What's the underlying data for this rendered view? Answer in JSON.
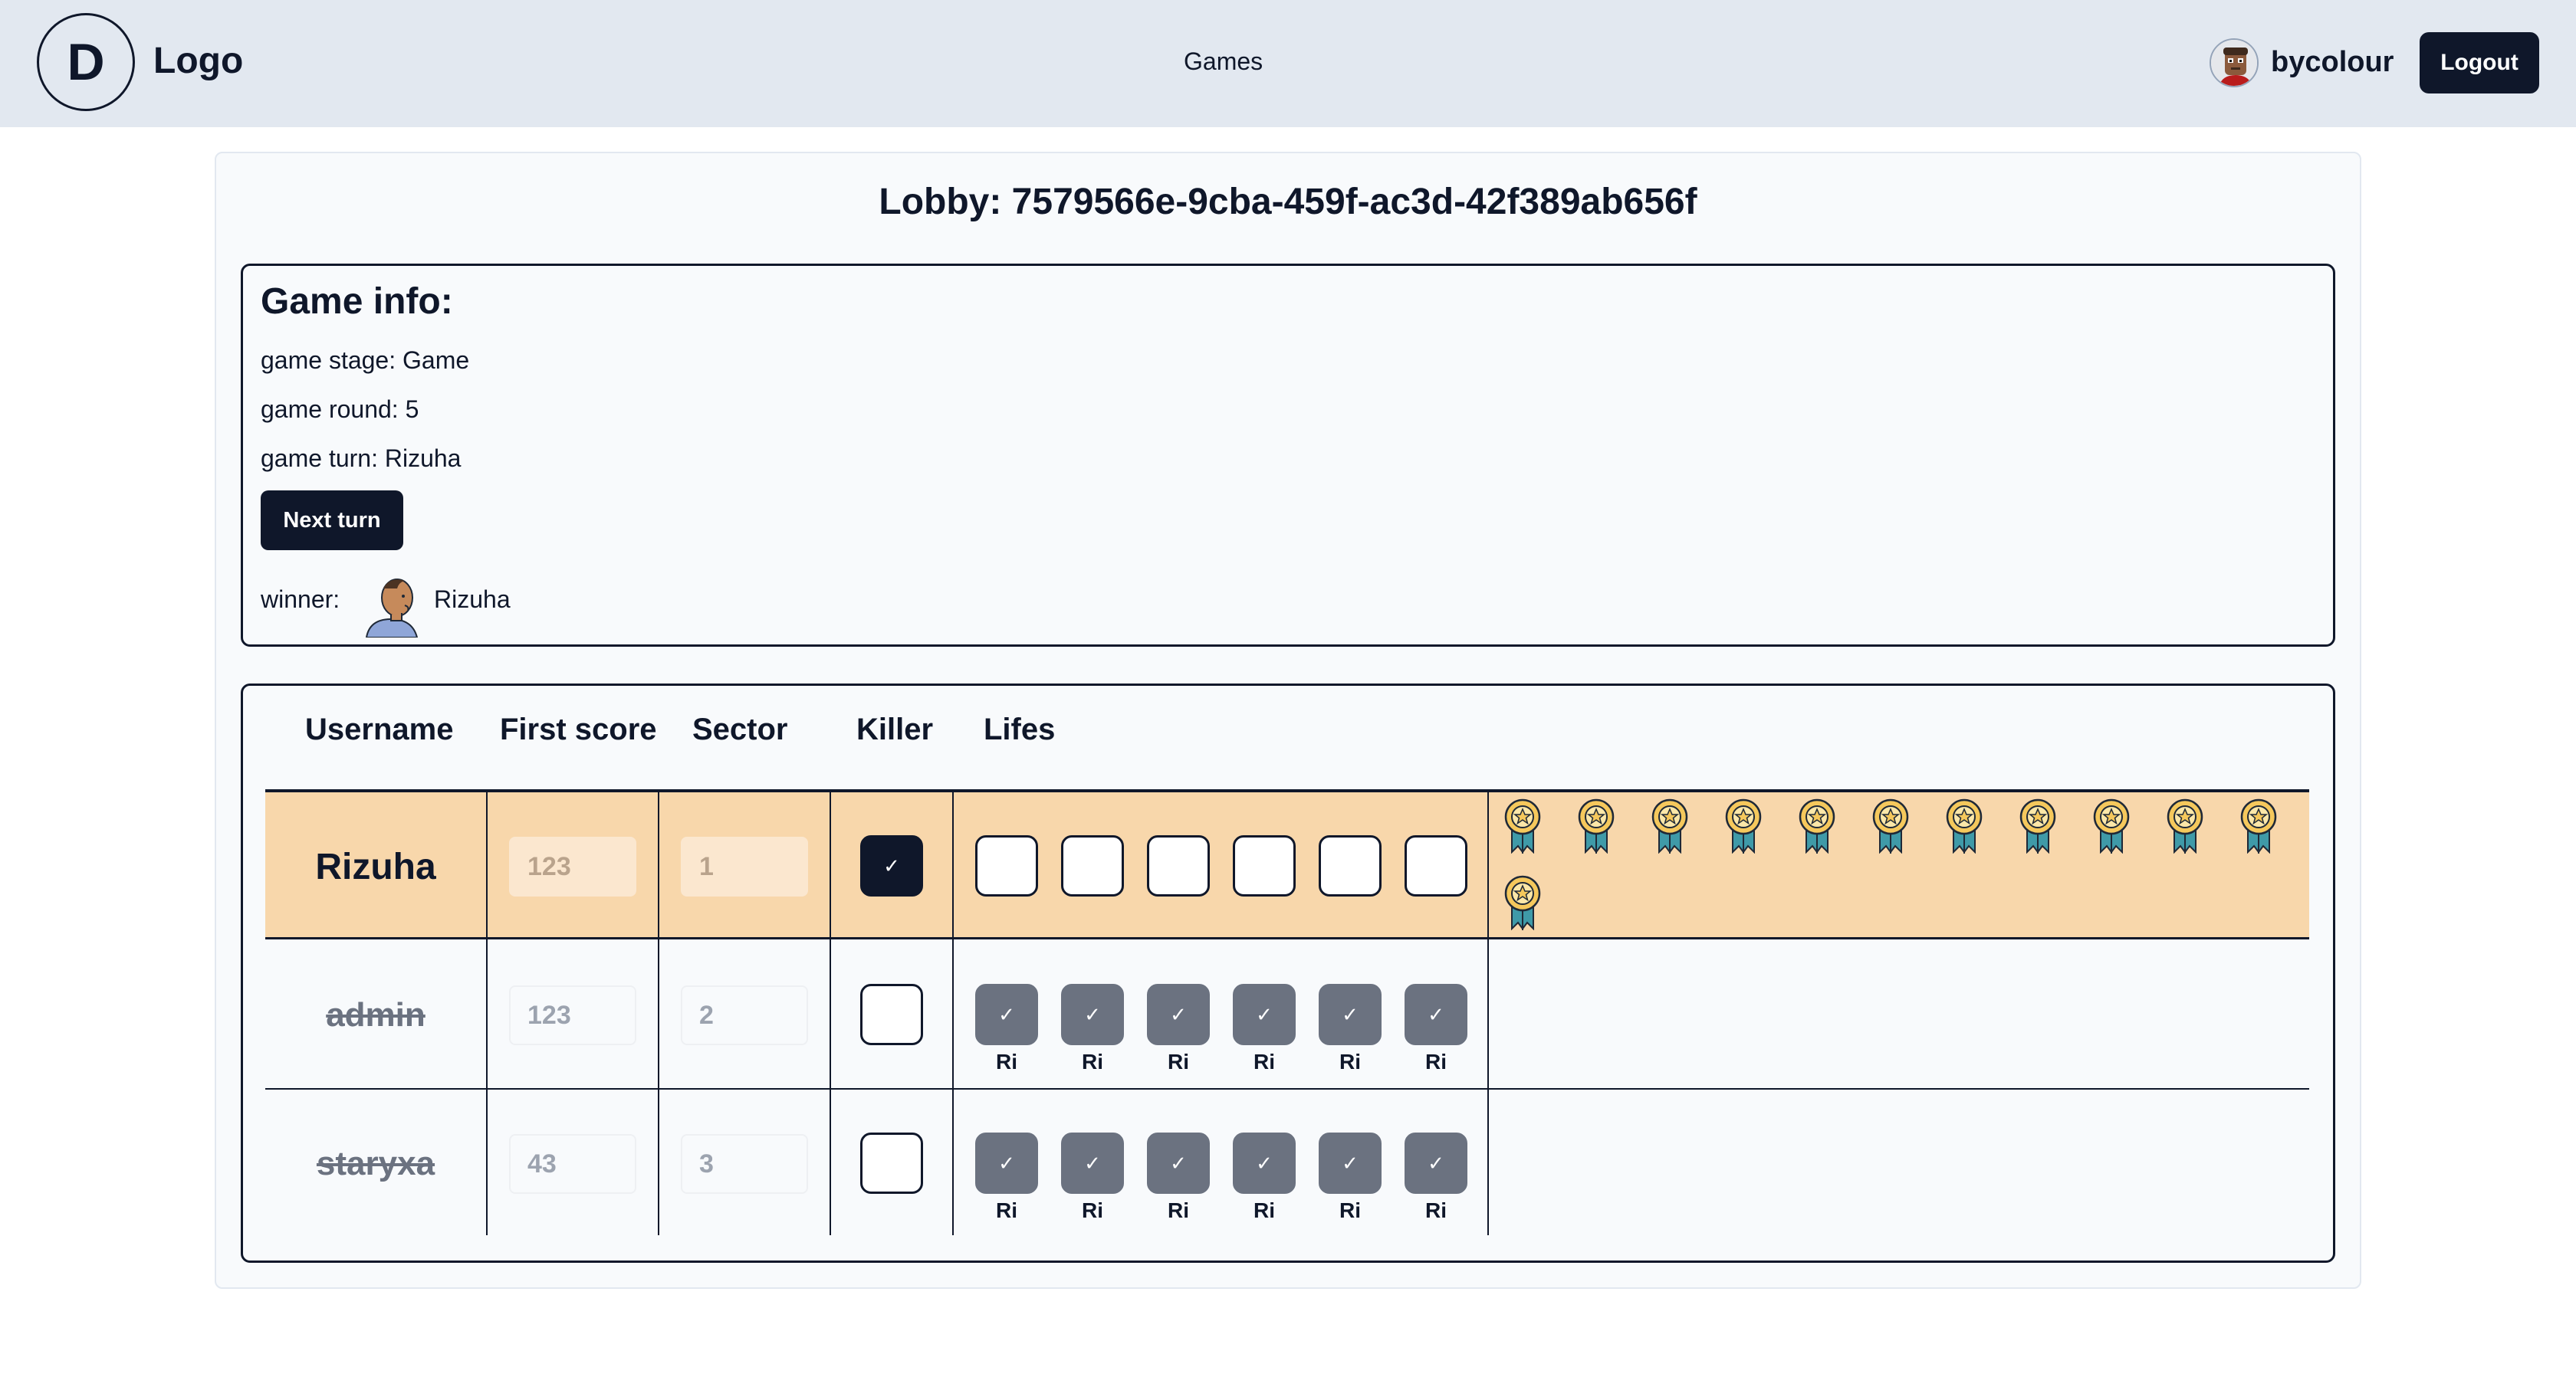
{
  "header": {
    "logo_letter": "D",
    "logo_text": "Logo",
    "nav": "Games",
    "username": "bycolour",
    "logout_label": "Logout"
  },
  "lobby": {
    "title": "Lobby: 7579566e-9cba-459f-ac3d-42f389ab656f"
  },
  "game_info": {
    "title": "Game info:",
    "stage": "game stage: Game",
    "round": "game round: 5",
    "turn": "game turn: Rizuha",
    "next_turn_label": "Next turn",
    "winner_label": "winner:",
    "winner_name": "Rizuha"
  },
  "table": {
    "headers": [
      "Username",
      "First score",
      "Sector",
      "Killer",
      "Lifes"
    ],
    "rows": [
      {
        "username": "Rizuha",
        "first_score": "123",
        "sector": "1",
        "killer": true,
        "eliminated": false,
        "lifes": [
          false,
          false,
          false,
          false,
          false,
          false
        ],
        "life_labels": [
          "",
          "",
          "",
          "",
          "",
          ""
        ],
        "medals": 12
      },
      {
        "username": "admin",
        "first_score": "123",
        "sector": "2",
        "killer": false,
        "eliminated": true,
        "lifes": [
          true,
          true,
          true,
          true,
          true,
          true
        ],
        "life_labels": [
          "Ri",
          "Ri",
          "Ri",
          "Ri",
          "Ri",
          "Ri"
        ],
        "medals": 0
      },
      {
        "username": "staryxa",
        "first_score": "43",
        "sector": "3",
        "killer": false,
        "eliminated": true,
        "lifes": [
          true,
          true,
          true,
          true,
          true,
          true
        ],
        "life_labels": [
          "Ri",
          "Ri",
          "Ri",
          "Ri",
          "Ri",
          "Ri"
        ],
        "medals": 0
      }
    ]
  },
  "colors": {
    "highlight_row": "#f8d7ab",
    "dark": "#0f172a",
    "checked_grey": "#6b7280"
  }
}
